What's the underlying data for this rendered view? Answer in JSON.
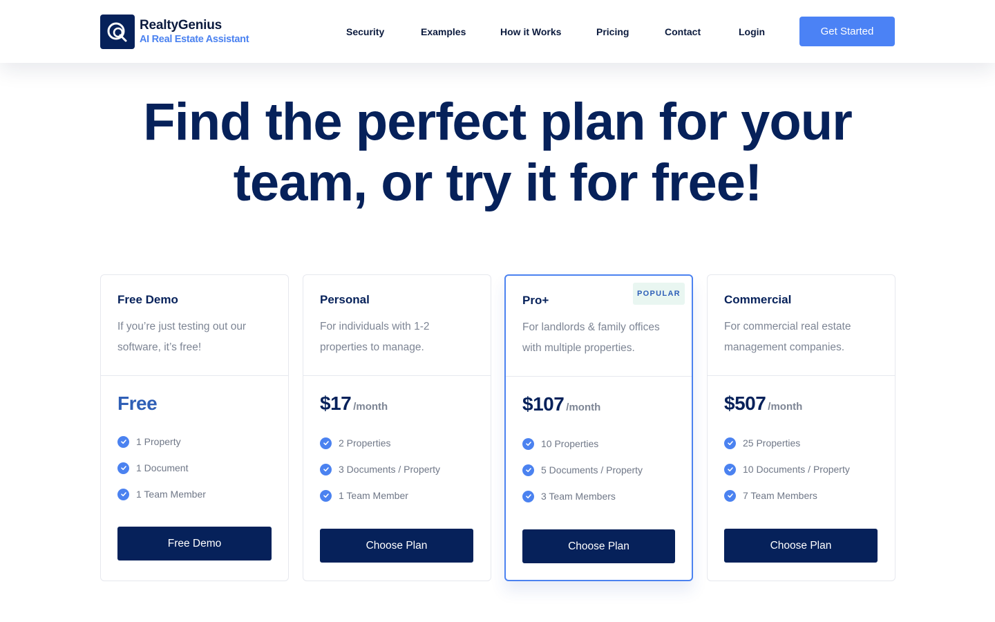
{
  "brand": {
    "name": "RealtyGenius",
    "tagline": "AI Real Estate Assistant"
  },
  "nav": {
    "items": [
      "Security",
      "Examples",
      "How it Works",
      "Pricing",
      "Contact",
      "Login"
    ],
    "cta_label": "Get Started"
  },
  "hero": {
    "title_line1": "Find the perfect plan for your",
    "title_line2": "team, or try it for free!"
  },
  "plans": [
    {
      "name": "Free Demo",
      "description": "If you’re just testing out our software, it’s free!",
      "price": "Free",
      "period": "",
      "features": [
        "1 Property",
        "1 Document",
        "1 Team Member"
      ],
      "button": "Free Demo"
    },
    {
      "name": "Personal",
      "description": "For individuals with 1-2 properties to manage.",
      "price": "$17",
      "period": "/month",
      "features": [
        "2 Properties",
        "3 Documents / Property",
        "1 Team Member"
      ],
      "button": "Choose Plan"
    },
    {
      "name": "Pro+",
      "badge": "POPULAR",
      "description": "For landlords & family offices with multiple properties.",
      "price": "$107",
      "period": "/month",
      "features": [
        "10 Properties",
        "5 Documents / Property",
        "3 Team Members"
      ],
      "button": "Choose Plan"
    },
    {
      "name": "Commercial",
      "description": "For commercial real estate management companies.",
      "price": "$507",
      "period": "/month",
      "features": [
        "25 Properties",
        "10 Documents / Property",
        "7 Team Members"
      ],
      "button": "Choose Plan"
    }
  ],
  "colors": {
    "navy": "#06215a",
    "accent_blue": "#4b82f5",
    "muted_text": "#7d8594",
    "badge_bg": "#e9f6f1"
  },
  "icons": {
    "logo": "chat-bubble-q-icon",
    "feature": "check-circle-icon"
  }
}
